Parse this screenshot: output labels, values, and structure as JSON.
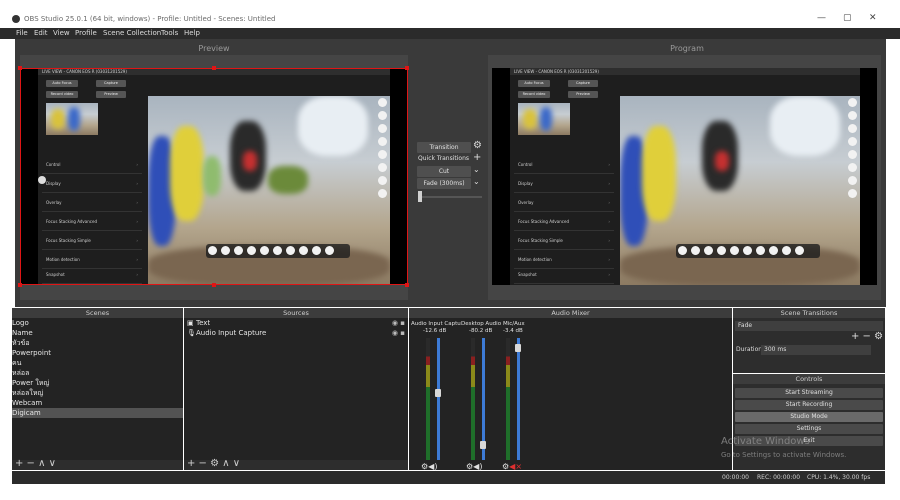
{
  "window": {
    "title": "OBS Studio 25.0.1 (64 bit, windows) - Profile: Untitled - Scenes: Untitled",
    "controls": [
      "—",
      "▢",
      "✕"
    ]
  },
  "menu": [
    "File",
    "Edit",
    "View",
    "Profile",
    "Scene Collection",
    "Tools",
    "Help"
  ],
  "preview": {
    "label": "Preview",
    "liveview_title": "LIVE VIEW - CANON EOS R (03031201529)",
    "buttons": [
      "Auto Focus",
      "Capture",
      "Record video",
      "Preview"
    ],
    "menu_items": [
      "Control",
      "Display",
      "Overlay",
      "Focus Stacking Advanced",
      "Focus Stacking Simple",
      "Motion detection",
      "Snapshot"
    ],
    "chevron": "›"
  },
  "program": {
    "label": "Program",
    "liveview_title": "LIVE VIEW - CANON EOS R (03031201529)",
    "buttons": [
      "Auto Focus",
      "Capture",
      "Record video",
      "Preview"
    ],
    "menu_items": [
      "Control",
      "Display",
      "Overlay",
      "Focus Stacking Advanced",
      "Focus Stacking Simple",
      "Motion detection",
      "Snapshot"
    ]
  },
  "transition_panel": {
    "transition_button": "Transition",
    "quick_transitions": "Quick Transitions",
    "cut": "Cut",
    "fade": "Fade (300ms)"
  },
  "scenes": {
    "title": "Scenes",
    "items": [
      "Logo",
      "Name",
      "หัวข้อ",
      "Powerpoint",
      "คน",
      "หล่อล",
      "Power ใหญ่",
      "หล่อลใหญ่",
      "Webcam",
      "Digicam"
    ],
    "selected": 9,
    "footer": "+ − ∧ ∨"
  },
  "sources": {
    "title": "Sources",
    "items": [
      {
        "name": "Text",
        "icon": "image-icon"
      },
      {
        "name": "Audio Input Capture",
        "icon": "microphone-icon"
      }
    ],
    "footer": "+ − ⚙ ∧ ∨"
  },
  "mixer": {
    "title": "Audio Mixer",
    "channels": [
      {
        "name": "Audio Input Captu",
        "db": "-12.6 dB",
        "level": 0.55,
        "muted": false
      },
      {
        "name": "Desktop Audio",
        "db": "-80.2 dB",
        "level": 0.1,
        "muted": false
      },
      {
        "name": "Mic/Aux",
        "db": "-3.4 dB",
        "level": 0.95,
        "muted": true
      }
    ],
    "ticks": [
      "0",
      "-5",
      "-10",
      "-15",
      "-20",
      "-25",
      "-30",
      "-35",
      "-40",
      "-45",
      "-50",
      "-55",
      "-60"
    ]
  },
  "scene_transitions": {
    "title": "Scene Transitions",
    "selected": "Fade",
    "duration_label": "Duration",
    "duration_value": "300 ms",
    "icons": "+ − ⚙"
  },
  "controls": {
    "title": "Controls",
    "buttons": [
      "Start Streaming",
      "Start Recording",
      "Studio Mode",
      "Settings",
      "Exit"
    ],
    "active": 2
  },
  "watermark": {
    "line1": "Activate Windows",
    "line2": "Go to Settings to activate Windows."
  },
  "statusbar": {
    "live": "00:00:00",
    "rec": "REC: 00:00:00",
    "cpu": "CPU: 1.4%, 30.00 fps"
  },
  "colors": {
    "selection_frame": "#e01515",
    "fader": "#3d7bd6",
    "dark_bg": "#3a3a3a"
  }
}
